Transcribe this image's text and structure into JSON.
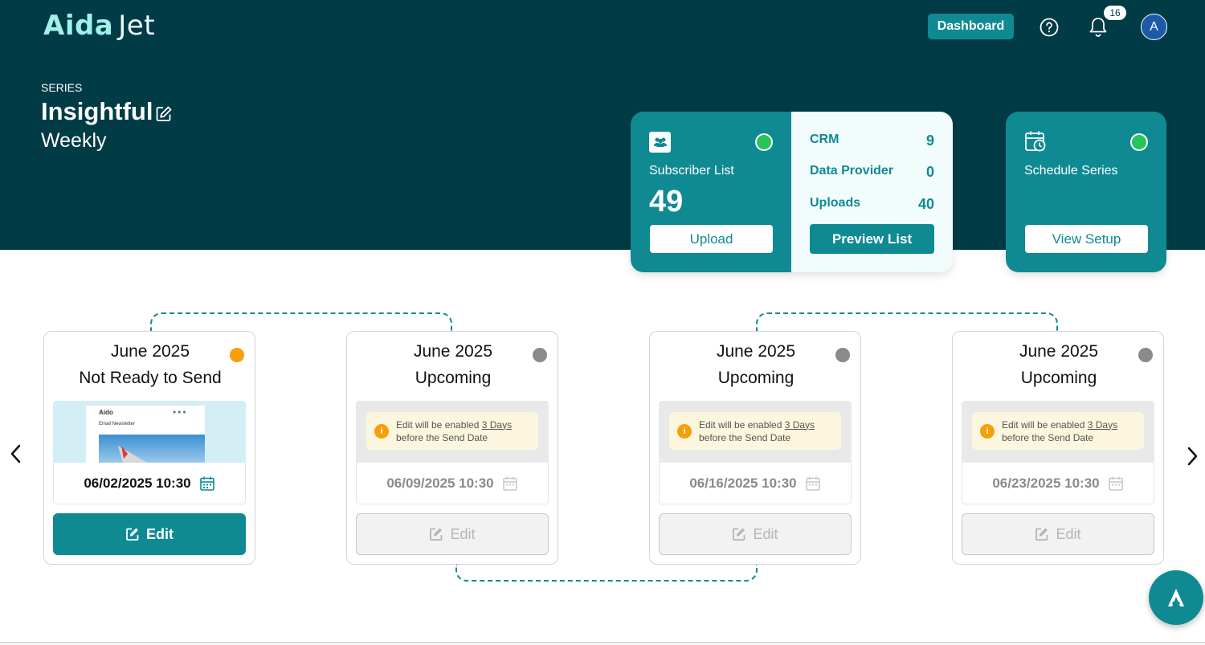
{
  "header": {
    "logo_primary": "Aida",
    "logo_secondary": "Jet",
    "dashboard_label": "Dashboard",
    "notification_count": "16",
    "avatar_initial": "A"
  },
  "series": {
    "label": "SERIES",
    "title": "Insightful",
    "frequency": "Weekly"
  },
  "subscriber_card": {
    "label": "Subscriber List",
    "count": "49",
    "upload_label": "Upload",
    "preview_label": "Preview List",
    "stats": [
      {
        "label": "CRM",
        "value": "9"
      },
      {
        "label": "Data Provider",
        "value": "0"
      },
      {
        "label": "Uploads",
        "value": "40"
      }
    ]
  },
  "schedule_card": {
    "label": "Schedule Series",
    "view_setup_label": "View Setup"
  },
  "emails": [
    {
      "month": "June 2025",
      "status": "Not Ready to Send",
      "date": "06/02/2025 10:30",
      "edit_label": "Edit",
      "preview_logo": "Aido",
      "preview_title": "Email Newsletter"
    },
    {
      "month": "June 2025",
      "status": "Upcoming",
      "date": "06/09/2025 10:30",
      "edit_label": "Edit",
      "warning_prefix": "Edit will be enabled ",
      "warning_link": "3 Days",
      "warning_suffix": "before the Send Date"
    },
    {
      "month": "June 2025",
      "status": "Upcoming",
      "date": "06/16/2025 10:30",
      "edit_label": "Edit",
      "warning_prefix": "Edit will be enabled ",
      "warning_link": "3 Days",
      "warning_suffix": "before the Send Date"
    },
    {
      "month": "June 2025",
      "status": "Upcoming",
      "date": "06/23/2025 10:30",
      "edit_label": "Edit",
      "warning_prefix": "Edit will be enabled ",
      "warning_link": "3 Days",
      "warning_suffix": "before the Send Date"
    }
  ],
  "colors": {
    "hero_bg": "#003b46",
    "accent": "#0f8a93",
    "status_ready": "#27c45a",
    "status_not_ready": "#f5a00a",
    "status_upcoming": "#8a8a8a"
  }
}
